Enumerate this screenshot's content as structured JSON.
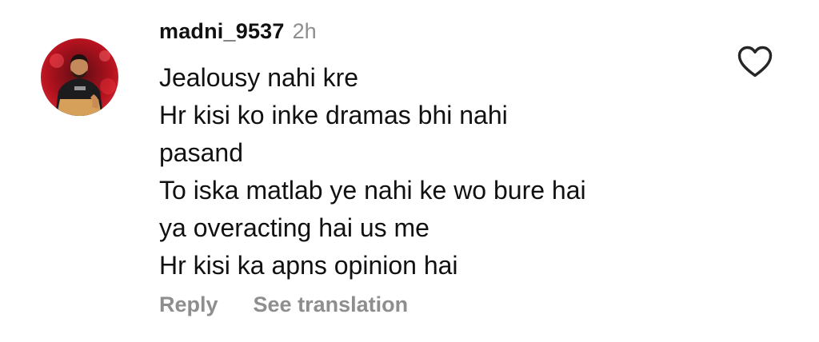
{
  "comment": {
    "username": "madni_9537",
    "timestamp": "2h",
    "lines": [
      "Jealousy nahi kre",
      "Hr kisi ko inke dramas bhi nahi",
      "pasand",
      "To iska matlab ye nahi ke wo bure hai",
      "ya overacting hai us me",
      "Hr kisi ka apns opinion hai"
    ],
    "reply_label": "Reply",
    "translate_label": "See translation",
    "avatar_icon": "user-avatar-photo",
    "like_icon": "heart-outline-icon"
  },
  "colors": {
    "text": "#111111",
    "secondary": "#8e8e8e",
    "background": "#ffffff"
  }
}
